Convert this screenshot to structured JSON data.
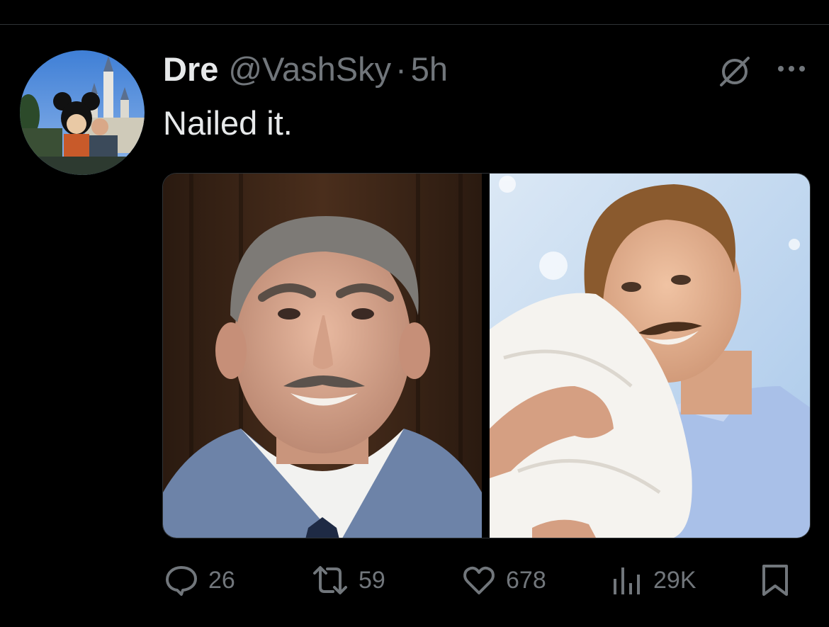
{
  "tweet": {
    "author_name": "Dre",
    "author_handle": "@VashSky",
    "separator": "·",
    "timestamp": "5h",
    "text": "Nailed it."
  },
  "media": [
    {
      "description_icon": "photo-waxfigure-man-blue-jacket"
    },
    {
      "description_icon": "photo-man-hugging-pillow"
    }
  ],
  "actions": {
    "replies": "26",
    "reposts": "59",
    "likes": "678",
    "views": "29K"
  },
  "icons": {
    "reply": "reply-icon",
    "repost": "repost-icon",
    "like": "heart-icon",
    "views": "views-chart-icon",
    "bookmark": "bookmark-icon",
    "grok": "grok-icon",
    "more": "more-icon"
  },
  "colors": {
    "background": "#000000",
    "text_primary": "#e7e9ea",
    "text_secondary": "#71767b"
  }
}
